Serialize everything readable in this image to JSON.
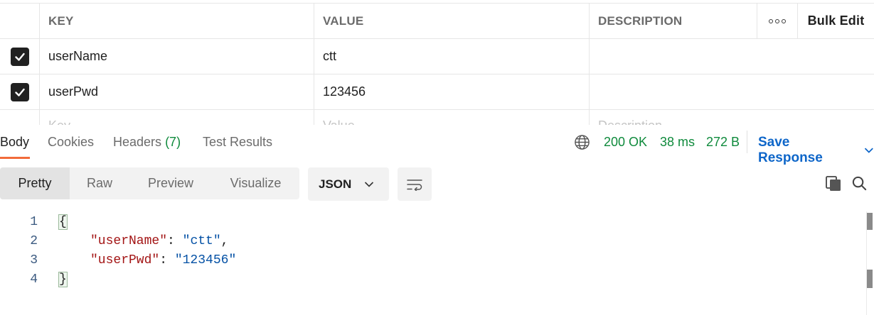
{
  "params_table": {
    "headers": {
      "key": "KEY",
      "value": "VALUE",
      "description": "DESCRIPTION",
      "bulk_edit": "Bulk Edit",
      "more_icon": "ellipsis-icon"
    },
    "rows": [
      {
        "checked": true,
        "key": "userName",
        "value": "ctt",
        "description": ""
      },
      {
        "checked": true,
        "key": "userPwd",
        "value": "123456",
        "description": ""
      }
    ],
    "placeholders": {
      "key": "Key",
      "value": "Value",
      "description": "Description"
    }
  },
  "response_tabs": [
    {
      "label": "Body",
      "active": true
    },
    {
      "label": "Cookies"
    },
    {
      "label": "Headers",
      "count": "(7)"
    },
    {
      "label": "Test Results"
    }
  ],
  "response_meta": {
    "globe_icon": "globe-icon",
    "status": "200 OK",
    "time": "38 ms",
    "size": "272 B",
    "save_response": "Save Response"
  },
  "view_modes": [
    {
      "label": "Pretty",
      "active": true
    },
    {
      "label": "Raw"
    },
    {
      "label": "Preview"
    },
    {
      "label": "Visualize"
    }
  ],
  "format_select": {
    "value": "JSON"
  },
  "code_lines": [
    {
      "number": "1",
      "text": "{"
    },
    {
      "number": "2",
      "key": "\"userName\"",
      "value": "\"ctt\"",
      "suffix": ","
    },
    {
      "number": "3",
      "key": "\"userPwd\"",
      "value": "\"123456\"",
      "suffix": ""
    },
    {
      "number": "4",
      "text": "}"
    }
  ],
  "colors": {
    "accent_underline": "#f26b3a",
    "status_green": "#0f8a3c",
    "link_blue": "#0e66c9"
  }
}
